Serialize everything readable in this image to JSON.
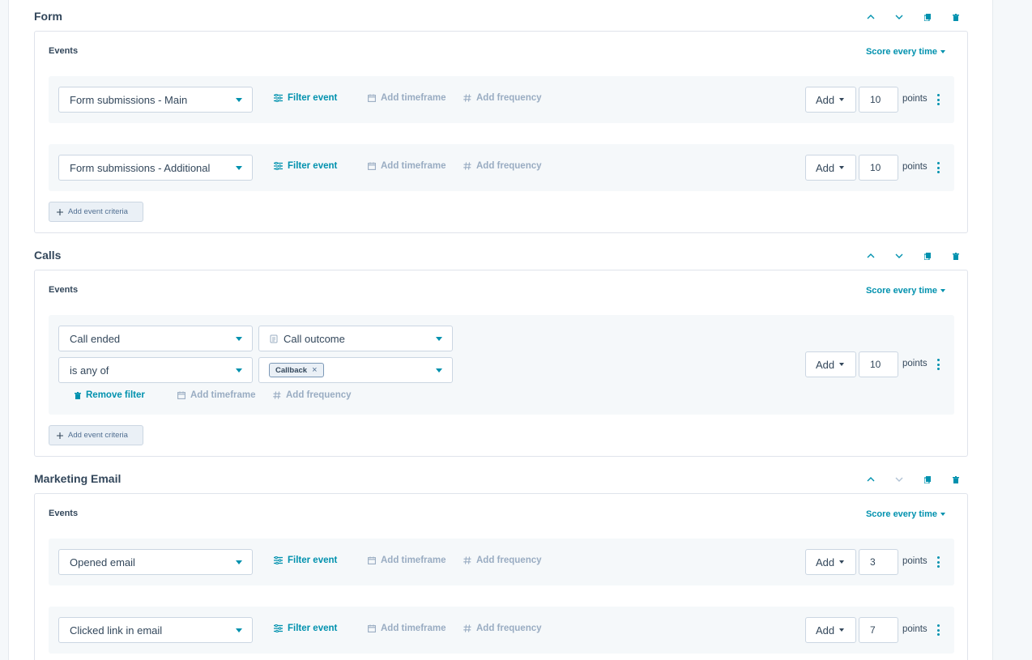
{
  "common": {
    "events_label": "Events",
    "score_every_time": "Score every time",
    "filter_event": "Filter event",
    "add_timeframe": "Add timeframe",
    "add_frequency": "Add frequency",
    "add_label": "Add",
    "points_label": "points",
    "add_event_criteria": "Add event criteria",
    "remove_filter": "Remove filter"
  },
  "sections": {
    "form": {
      "title": "Form",
      "rows": [
        {
          "event": "Form submissions - Main",
          "points": "10"
        },
        {
          "event": "Form submissions - Additional",
          "points": "10"
        }
      ]
    },
    "calls": {
      "title": "Calls",
      "event": "Call ended",
      "property": "Call outcome",
      "operator": "is any of",
      "value_chip": "Callback",
      "points": "10"
    },
    "marketing_email": {
      "title": "Marketing Email",
      "rows": [
        {
          "event": "Opened email",
          "points": "3"
        },
        {
          "event": "Clicked link in email",
          "points": "7"
        }
      ]
    }
  },
  "colors": {
    "accent": "#0091ae",
    "text": "#33475b",
    "muted": "#99acc2",
    "row_bg": "#f5f8fa",
    "border": "#cbd6e2"
  }
}
